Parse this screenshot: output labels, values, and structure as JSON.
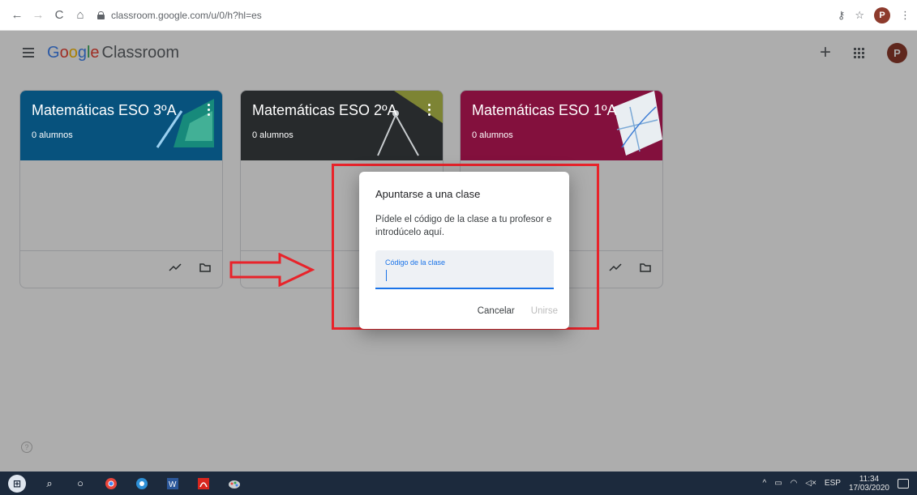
{
  "browser": {
    "url": "classroom.google.com/u/0/h?hl=es",
    "profile_initial": "P"
  },
  "app": {
    "logo_google": [
      "G",
      "o",
      "o",
      "g",
      "l",
      "e"
    ],
    "logo_product": "Classroom",
    "avatar_initial": "P"
  },
  "cards": [
    {
      "title": "Matemáticas ESO 3ºA",
      "subtitle": "0 alumnos",
      "color": "#0b7ab8"
    },
    {
      "title": "Matemáticas ESO 2ºA",
      "subtitle": "0 alumnos",
      "color": "#3a3f42"
    },
    {
      "title": "Matemáticas ESO 1ºA",
      "subtitle": "0 alumnos",
      "color": "#c2185b"
    }
  ],
  "dialog": {
    "title": "Apuntarse a una clase",
    "text": "Pídele el código de la clase a tu profesor e introdúcelo aquí.",
    "field_label": "Código de la clase",
    "field_value": "",
    "cancel_label": "Cancelar",
    "join_label": "Unirse"
  },
  "taskbar": {
    "language": "ESP",
    "time": "11:34",
    "date": "17/03/2020"
  },
  "colors": {
    "accent": "#1a73e8",
    "highlight_red": "#e8232a"
  }
}
